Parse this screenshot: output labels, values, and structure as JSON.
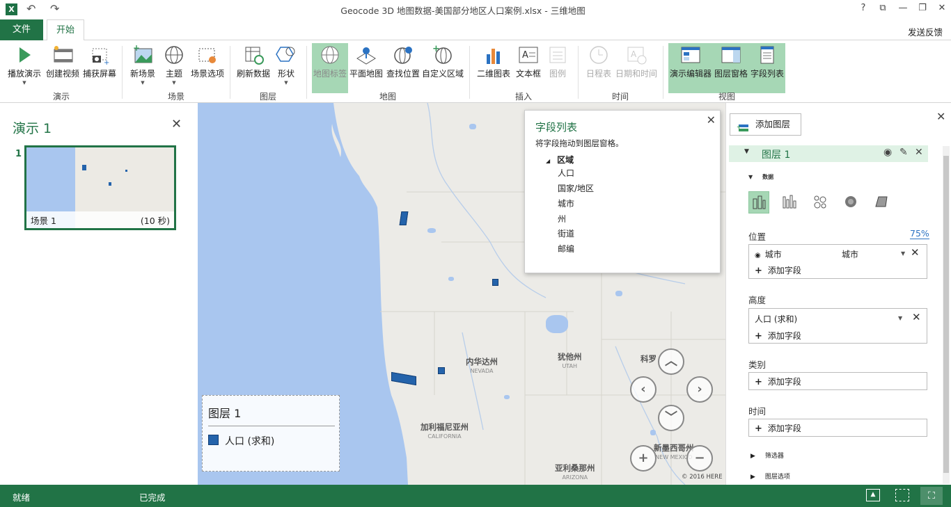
{
  "window": {
    "title": "Geocode 3D 地图数据-美国部分地区人口案例.xlsx - 三维地图",
    "help": "?",
    "restore": "⧉",
    "minimize": "—",
    "maximize": "❐",
    "close": "✕"
  },
  "ribbon_tabs": {
    "file": "文件",
    "home": "开始"
  },
  "feedback": "发送反馈",
  "ribbon": {
    "tour": {
      "label": "演示",
      "play": "播放演示",
      "create_video": "创建视频",
      "capture": "捕获屏幕"
    },
    "scene": {
      "label": "场景",
      "new_scene": "新场景",
      "theme": "主题",
      "scene_options": "场景选项"
    },
    "layer": {
      "label": "图层",
      "refresh": "刷新数据",
      "shapes": "形状"
    },
    "map": {
      "label": "地图",
      "map_labels": "地图标签",
      "flat_map": "平面地图",
      "find_location": "查找位置",
      "custom_regions": "自定义区域"
    },
    "insert": {
      "label": "插入",
      "chart_2d": "二维图表",
      "text_box": "文本框",
      "legend": "图例"
    },
    "time": {
      "label": "时间",
      "timeline": "日程表",
      "date_time": "日期和时间"
    },
    "view": {
      "label": "视图",
      "tour_editor": "演示编辑器",
      "layer_pane": "图层窗格",
      "field_list": "字段列表"
    }
  },
  "tour_pane": {
    "title": "演示 1",
    "close": "✕",
    "scene_number": "1",
    "scene_name": "场景 1",
    "scene_duration": "(10 秒)"
  },
  "map": {
    "labels": [
      {
        "cn": "内华达州",
        "en": "NEVADA"
      },
      {
        "cn": "犹他州",
        "en": "UTAH"
      },
      {
        "cn": "科罗",
        "en": ""
      },
      {
        "cn": "加利福尼亚州",
        "en": "CALIFORNIA"
      },
      {
        "cn": "亚利桑那州",
        "en": "ARIZONA"
      },
      {
        "cn": "新墨西哥州",
        "en": "NEW MEXICO"
      }
    ],
    "copyright": "© 2016 HERE",
    "nav": {
      "up": "︿",
      "left": "‹",
      "right": "›",
      "down": "﹀",
      "zoom_in": "+",
      "zoom_out": "−"
    }
  },
  "field_list": {
    "title": "字段列表",
    "subtitle": "将字段拖动到图层窗格。",
    "close": "✕",
    "group": "区域",
    "fields": [
      "人口",
      "国家/地区",
      "城市",
      "州",
      "街道",
      "邮编"
    ]
  },
  "legend": {
    "title": "图层 1",
    "item": "人口 (求和)",
    "color": "#2463ab"
  },
  "layer_pane": {
    "close": "✕",
    "add_layer": "添加图层",
    "layer_name": "图层 1",
    "data_section": "数据",
    "position": {
      "label": "位置",
      "percent": "75%",
      "field_name": "城市",
      "field_type": "城市",
      "add": "添加字段"
    },
    "height": {
      "label": "高度",
      "field": "人口 (求和)",
      "add": "添加字段"
    },
    "category": {
      "label": "类别",
      "add": "添加字段"
    },
    "time": {
      "label": "时间",
      "add": "添加字段"
    },
    "filters": "筛选器",
    "layer_options": "图层选项"
  },
  "status": {
    "ready": "就绪",
    "done": "已完成"
  },
  "colors": {
    "accent": "#217346",
    "highlight": "#a6d7b5",
    "water": "#a9c6ef",
    "bar": "#2463ab"
  }
}
